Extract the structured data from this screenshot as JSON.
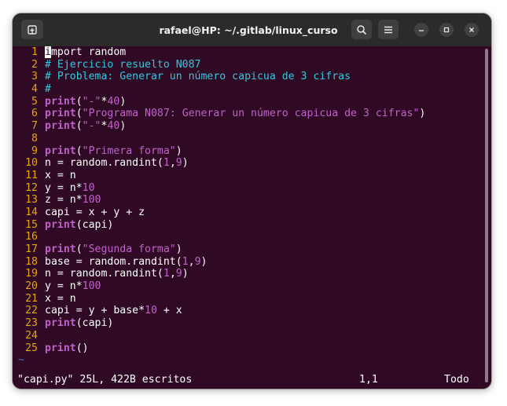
{
  "window": {
    "title": "rafael@HP: ~/.gitlab/linux_curso"
  },
  "titlebar_icons": {
    "new_tab": "new-tab-icon",
    "search": "search-icon",
    "menu": "hamburger-menu-icon",
    "minimize": "minimize-icon",
    "maximize": "maximize-icon",
    "close": "close-icon"
  },
  "code_lines": [
    {
      "n": "1",
      "segs": [
        {
          "t": "",
          "c": "cursor"
        },
        {
          "t": "import random",
          "c": ""
        }
      ]
    },
    {
      "n": "2",
      "segs": [
        {
          "t": "# Ejercicio resuelto N087",
          "c": "c"
        }
      ]
    },
    {
      "n": "3",
      "segs": [
        {
          "t": "# Problema: Generar un número capicua de 3 cifras",
          "c": "c"
        }
      ]
    },
    {
      "n": "4",
      "segs": [
        {
          "t": "#",
          "c": "c"
        }
      ]
    },
    {
      "n": "5",
      "segs": [
        {
          "t": "print",
          "c": "k"
        },
        {
          "t": "(",
          "c": ""
        },
        {
          "t": "\"-\"",
          "c": "s"
        },
        {
          "t": "*",
          "c": ""
        },
        {
          "t": "40",
          "c": "n"
        },
        {
          "t": ")",
          "c": ""
        }
      ]
    },
    {
      "n": "6",
      "segs": [
        {
          "t": "print",
          "c": "k"
        },
        {
          "t": "(",
          "c": ""
        },
        {
          "t": "\"Programa N087: Generar un número capicua de 3 cifras\"",
          "c": "s"
        },
        {
          "t": ")",
          "c": ""
        }
      ]
    },
    {
      "n": "7",
      "segs": [
        {
          "t": "print",
          "c": "k"
        },
        {
          "t": "(",
          "c": ""
        },
        {
          "t": "\"-\"",
          "c": "s"
        },
        {
          "t": "*",
          "c": ""
        },
        {
          "t": "40",
          "c": "n"
        },
        {
          "t": ")",
          "c": ""
        }
      ]
    },
    {
      "n": "8",
      "segs": []
    },
    {
      "n": "9",
      "segs": [
        {
          "t": "print",
          "c": "k"
        },
        {
          "t": "(",
          "c": ""
        },
        {
          "t": "\"Primera forma\"",
          "c": "s"
        },
        {
          "t": ")",
          "c": ""
        }
      ]
    },
    {
      "n": "10",
      "segs": [
        {
          "t": "n = random.randint(",
          "c": ""
        },
        {
          "t": "1",
          "c": "n"
        },
        {
          "t": ",",
          "c": ""
        },
        {
          "t": "9",
          "c": "n"
        },
        {
          "t": ")",
          "c": ""
        }
      ]
    },
    {
      "n": "11",
      "segs": [
        {
          "t": "x = n",
          "c": ""
        }
      ]
    },
    {
      "n": "12",
      "segs": [
        {
          "t": "y = n*",
          "c": ""
        },
        {
          "t": "10",
          "c": "n"
        }
      ]
    },
    {
      "n": "13",
      "segs": [
        {
          "t": "z = n*",
          "c": ""
        },
        {
          "t": "100",
          "c": "n"
        }
      ]
    },
    {
      "n": "14",
      "segs": [
        {
          "t": "capi = x + y + z",
          "c": ""
        }
      ]
    },
    {
      "n": "15",
      "segs": [
        {
          "t": "print",
          "c": "k"
        },
        {
          "t": "(capi)",
          "c": ""
        }
      ]
    },
    {
      "n": "16",
      "segs": []
    },
    {
      "n": "17",
      "segs": [
        {
          "t": "print",
          "c": "k"
        },
        {
          "t": "(",
          "c": ""
        },
        {
          "t": "\"Segunda forma\"",
          "c": "s"
        },
        {
          "t": ")",
          "c": ""
        }
      ]
    },
    {
      "n": "18",
      "segs": [
        {
          "t": "base = random.randint(",
          "c": ""
        },
        {
          "t": "1",
          "c": "n"
        },
        {
          "t": ",",
          "c": ""
        },
        {
          "t": "9",
          "c": "n"
        },
        {
          "t": ")",
          "c": ""
        }
      ]
    },
    {
      "n": "19",
      "segs": [
        {
          "t": "n = random.randint(",
          "c": ""
        },
        {
          "t": "1",
          "c": "n"
        },
        {
          "t": ",",
          "c": ""
        },
        {
          "t": "9",
          "c": "n"
        },
        {
          "t": ")",
          "c": ""
        }
      ]
    },
    {
      "n": "20",
      "segs": [
        {
          "t": "y = n*",
          "c": ""
        },
        {
          "t": "100",
          "c": "n"
        }
      ]
    },
    {
      "n": "21",
      "segs": [
        {
          "t": "x = n",
          "c": ""
        }
      ]
    },
    {
      "n": "22",
      "segs": [
        {
          "t": "capi = y + base*",
          "c": ""
        },
        {
          "t": "10",
          "c": "n"
        },
        {
          "t": " + x",
          "c": ""
        }
      ]
    },
    {
      "n": "23",
      "segs": [
        {
          "t": "print",
          "c": "k"
        },
        {
          "t": "(capi)",
          "c": ""
        }
      ]
    },
    {
      "n": "24",
      "segs": []
    },
    {
      "n": "25",
      "segs": [
        {
          "t": "print",
          "c": "k"
        },
        {
          "t": "()",
          "c": ""
        }
      ]
    }
  ],
  "empty_marker": "~",
  "status": {
    "message": "\"capi.py\" 25L, 422B escritos",
    "position": "1,1",
    "scroll": "Todo"
  },
  "colors": {
    "background": "#300a24",
    "line_numbers": "#e5a50a",
    "keyword": "#c061cb",
    "comment": "#33c7de",
    "tilde": "#4e6fd2"
  }
}
